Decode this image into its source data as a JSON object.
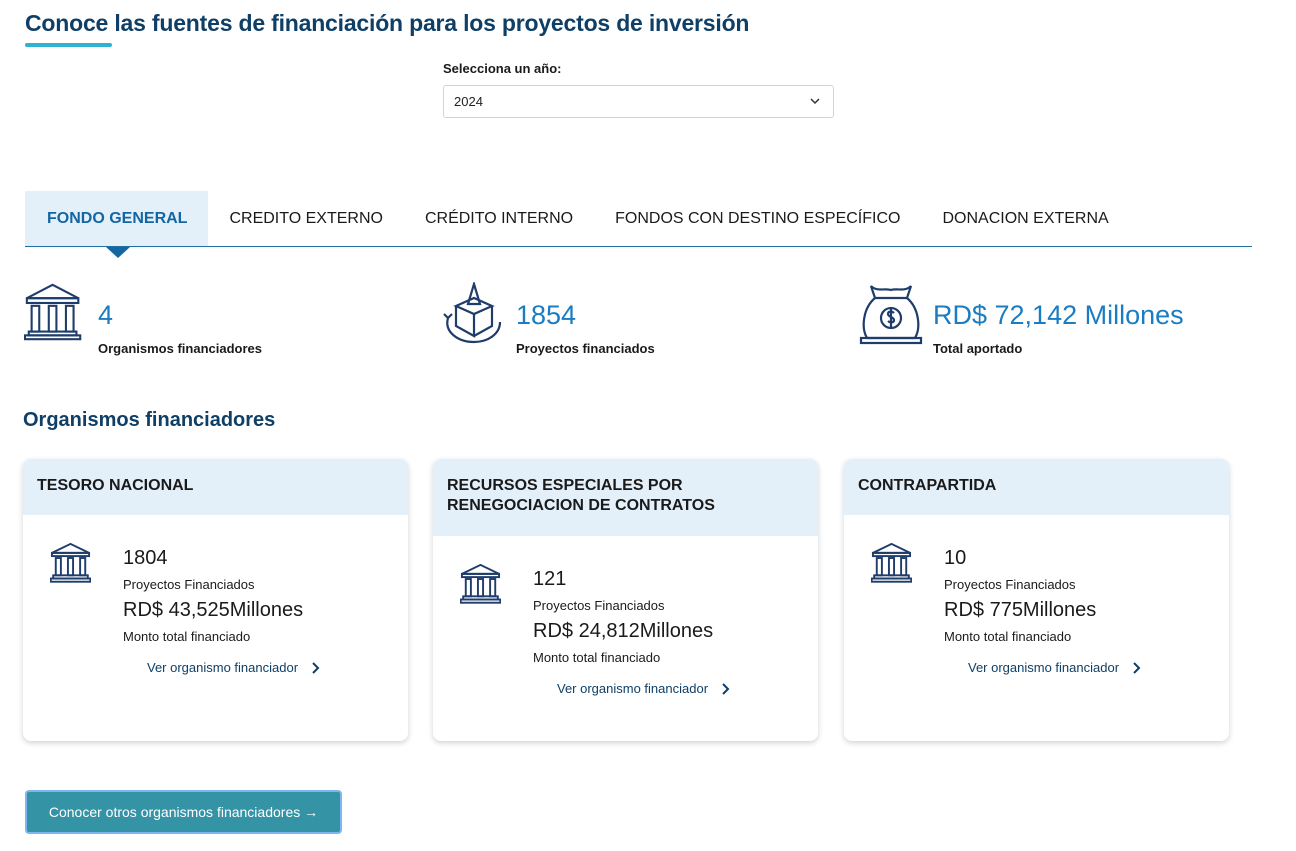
{
  "page": {
    "title": "Conoce las fuentes de financiación para los proyectos de inversión"
  },
  "year_filter": {
    "label": "Selecciona un año:",
    "selected": "2024"
  },
  "tabs": [
    {
      "label": "FONDO GENERAL",
      "active": true
    },
    {
      "label": "CREDITO EXTERNO",
      "active": false
    },
    {
      "label": "CRÉDITO INTERNO",
      "active": false
    },
    {
      "label": "FONDOS CON DESTINO ESPECÍFICO",
      "active": false
    },
    {
      "label": "DONACION EXTERNA",
      "active": false
    }
  ],
  "stats": [
    {
      "icon": "bank-icon",
      "value": "4",
      "label": "Organismos financiadores"
    },
    {
      "icon": "project-box-icon",
      "value": "1854",
      "label": "Proyectos financiados"
    },
    {
      "icon": "money-bag-icon",
      "value": "RD$ 72,142 Millones",
      "label": "Total aportado"
    }
  ],
  "section": {
    "title": "Organismos financiadores"
  },
  "cards": [
    {
      "name": "TESORO NACIONAL",
      "projects": "1804",
      "projects_label": "Proyectos Financiados",
      "amount": "RD$ 43,525Millones",
      "amount_label": "Monto total financiado",
      "link": "Ver organismo financiador"
    },
    {
      "name": "RECURSOS ESPECIALES POR RENEGOCIACION DE CONTRATOS",
      "projects": "121",
      "projects_label": "Proyectos Financiados",
      "amount": "RD$ 24,812Millones",
      "amount_label": "Monto total financiado",
      "link": "Ver organismo financiador"
    },
    {
      "name": "CONTRAPARTIDA",
      "projects": "10",
      "projects_label": "Proyectos Financiados",
      "amount": "RD$ 775Millones",
      "amount_label": "Monto total financiado",
      "link": "Ver organismo financiador"
    }
  ],
  "cta": {
    "label": "Conocer otros organismos financiadores →"
  },
  "colors": {
    "title": "#0f3f66",
    "accent": "#1a7cc2",
    "tab_active_bg": "#e3f0fa",
    "cta_bg": "#3593a6",
    "underline": "#2bb3d1"
  }
}
